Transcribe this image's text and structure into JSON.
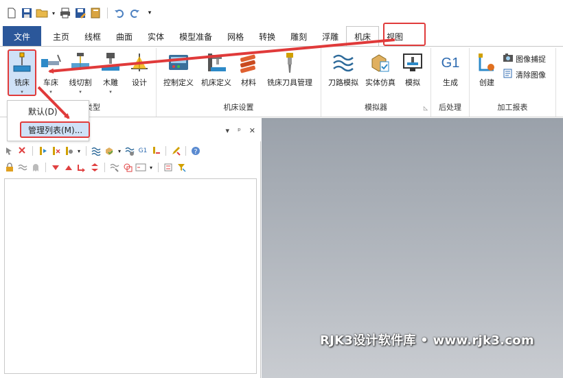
{
  "tabs": {
    "file": "文件",
    "items": [
      "主页",
      "线框",
      "曲面",
      "实体",
      "模型准备",
      "网格",
      "转换",
      "雕刻",
      "浮雕",
      "机床",
      "视图"
    ],
    "active_index": 9
  },
  "ribbon": {
    "machine_type": {
      "label": "类型",
      "buttons": [
        {
          "label": "铣床",
          "has_dropdown": true
        },
        {
          "label": "车床",
          "has_dropdown": true
        },
        {
          "label": "线切割",
          "has_dropdown": true
        },
        {
          "label": "木雕",
          "has_dropdown": true
        },
        {
          "label": "设计",
          "has_dropdown": false
        }
      ]
    },
    "machine_setup": {
      "label": "机床设置",
      "buttons": [
        "控制定义",
        "机床定义",
        "材料",
        "铣床刀具管理"
      ]
    },
    "simulator": {
      "label": "模拟器",
      "buttons": [
        "刀路模拟",
        "实体仿真",
        "模拟"
      ]
    },
    "post": {
      "label": "后处理",
      "icon_text": "G1",
      "buttons": [
        "生成"
      ]
    },
    "report": {
      "label": "加工报表",
      "buttons": [
        "创建"
      ],
      "small_buttons": [
        "图像捕捉",
        "清除图像"
      ]
    }
  },
  "dropdown_menu": {
    "items": [
      "默认(D)",
      "管理列表(M)..."
    ],
    "highlighted_index": 1
  },
  "panel": {
    "controls": [
      "▾",
      "ᵖ",
      "✕"
    ]
  },
  "viewport": {
    "watermark": "RJK3设计软件库 • www.rjk3.com"
  },
  "colors": {
    "file_tab": "#2b579a",
    "annotation": "#e03a3a",
    "highlight": "#cfe1f7"
  }
}
